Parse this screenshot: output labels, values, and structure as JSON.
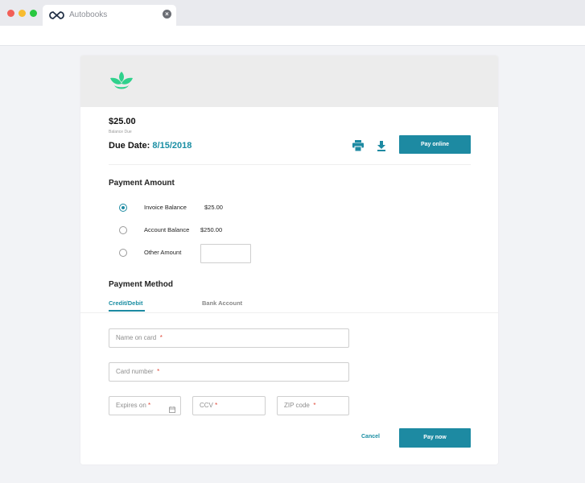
{
  "browser": {
    "tab_title": "Autobooks",
    "tab_close": "×"
  },
  "invoice": {
    "amount": "$25.00",
    "balance_due_label": "Balance Due",
    "due_date_label": "Due Date:",
    "due_date_value": "8/15/2018",
    "pay_online_label": "Pay online"
  },
  "payment_amount": {
    "title": "Payment Amount",
    "options": [
      {
        "label": "Invoice Balance",
        "value": "$25.00",
        "selected": true
      },
      {
        "label": "Account Balance",
        "value": "$250.00",
        "selected": false
      },
      {
        "label": "Other Amount",
        "value": "",
        "selected": false
      }
    ]
  },
  "payment_method": {
    "title": "Payment Method",
    "tabs": [
      {
        "label": "Credit/Debit",
        "active": true
      },
      {
        "label": "Bank Account",
        "active": false
      }
    ],
    "fields": {
      "name_on_card": {
        "placeholder": "Name on card",
        "required_mark": "*"
      },
      "card_number": {
        "placeholder": "Card number",
        "required_mark": "*"
      },
      "expires_on": {
        "placeholder": "Expires on",
        "required_mark": "*"
      },
      "ccv": {
        "placeholder": "CCV",
        "required_mark": "*"
      },
      "zip_code": {
        "placeholder": "ZIP code",
        "required_mark": "*"
      }
    },
    "cancel_label": "Cancel",
    "pay_now_label": "Pay now"
  },
  "icons": {
    "tab": "autobooks-logo-icon",
    "header_logo": "leaf-logo-icon",
    "print": "printer-icon",
    "download": "download-icon",
    "calendar": "calendar-icon"
  },
  "colors": {
    "accent": "#1d8aa2",
    "logo_green": "#2fd18c",
    "required": "#e14b3b"
  }
}
